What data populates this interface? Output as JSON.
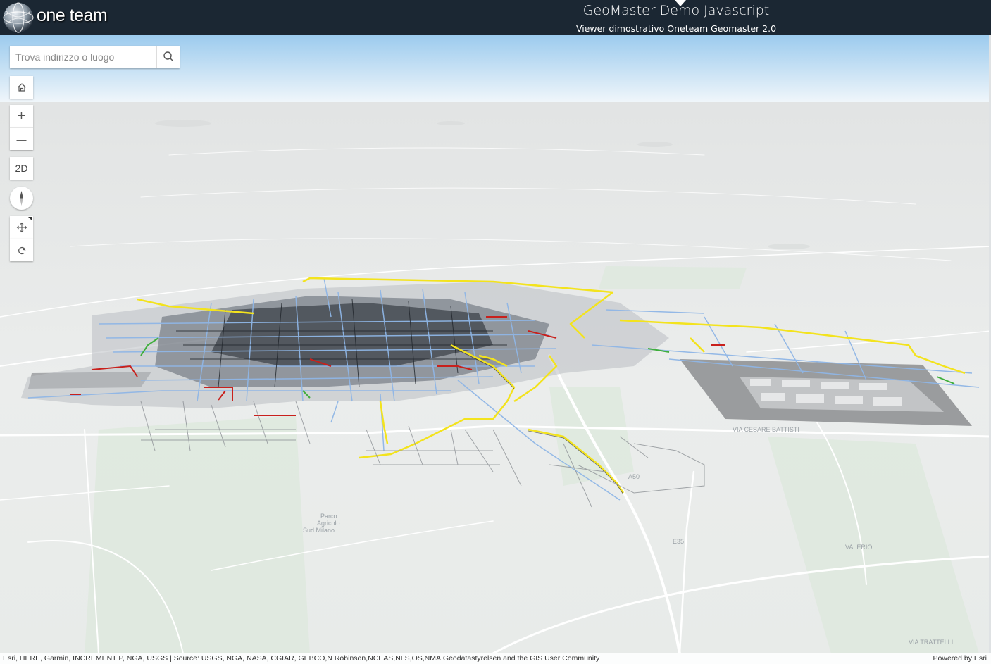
{
  "header": {
    "brand": "one team",
    "title": "GeoMaster Demo Javascript",
    "subtitle": "Viewer dimostrativo Oneteam Geomaster 2.0"
  },
  "search": {
    "placeholder": "Trova indirizzo o luogo",
    "icon": "search-icon"
  },
  "controls": {
    "home_icon": "home-icon",
    "zoom_in_label": "+",
    "zoom_out_label": "—",
    "view_toggle_label": "2D",
    "compass_icon": "compass-icon",
    "pan_icon": "pan-icon",
    "rotate_icon": "rotate-icon"
  },
  "map": {
    "labels": [
      "Parco",
      "Agricolo",
      "Sud Milano",
      "VIA CESARE BATTISTI",
      "E35",
      "A50",
      "VIA TRATTELLI",
      "VALERIO"
    ],
    "colors": {
      "sky": "#a9d4f0",
      "terrain": "#eceeed",
      "roads": "#ffffff",
      "network_blue": "#8fb6e6",
      "network_yellow": "#f3e31d",
      "network_red": "#c8201c",
      "network_green": "#3fae3c",
      "network_dark": "#2a2f36"
    }
  },
  "attribution": {
    "left": "Esri, HERE, Garmin, INCREMENT P, NGA, USGS | Source: USGS, NGA, NASA, CGIAR, GEBCO,N Robinson,NCEAS,NLS,OS,NMA,Geodatastyrelsen and the GIS User Community",
    "right_prefix": "Powered by ",
    "right_link": "Esri"
  }
}
